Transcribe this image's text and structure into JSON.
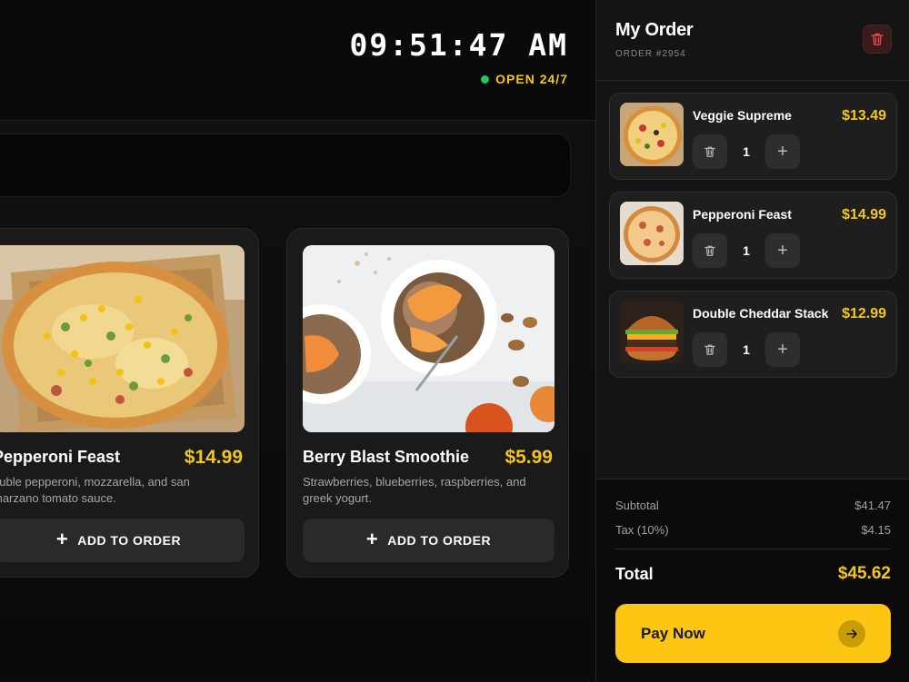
{
  "header": {
    "clock": "09:51:47 AM",
    "status_text": "OPEN 24/7",
    "status_color": "#22c55e"
  },
  "menu": {
    "items": [
      {
        "name": "Pepperoni Feast",
        "price": "$14.99",
        "description": "ouble pepperoni, mozzarella, and san marzano tomato sauce.",
        "button_label": "ADD TO ORDER",
        "image": "pizza-photo"
      },
      {
        "name": "Berry Blast Smoothie",
        "price": "$5.99",
        "description": "Strawberries, blueberries, raspberries, and greek yogurt.",
        "button_label": "ADD TO ORDER",
        "image": "smoothie-bowl-photo"
      }
    ]
  },
  "order": {
    "title": "My Order",
    "number": "ORDER #2954",
    "clear_icon": "trash-icon",
    "items": [
      {
        "name": "Veggie Supreme",
        "price": "$13.49",
        "quantity": "1",
        "image": "veggie-pizza-photo"
      },
      {
        "name": "Pepperoni Feast",
        "price": "$14.99",
        "quantity": "1",
        "image": "pepperoni-pizza-photo"
      },
      {
        "name": "Double Cheddar Stack",
        "price": "$12.99",
        "quantity": "1",
        "image": "burger-photo"
      }
    ],
    "summary": {
      "subtotal_label": "Subtotal",
      "subtotal_value": "$41.47",
      "tax_label": "Tax (10%)",
      "tax_value": "$4.15",
      "total_label": "Total",
      "total_value": "$45.62"
    },
    "pay_label": "Pay Now",
    "pay_icon": "arrow-right-icon"
  },
  "colors": {
    "accent": "#f5c518",
    "pay_button": "#fcc613",
    "background": "#0c0c0c",
    "danger": "#e5484d"
  }
}
